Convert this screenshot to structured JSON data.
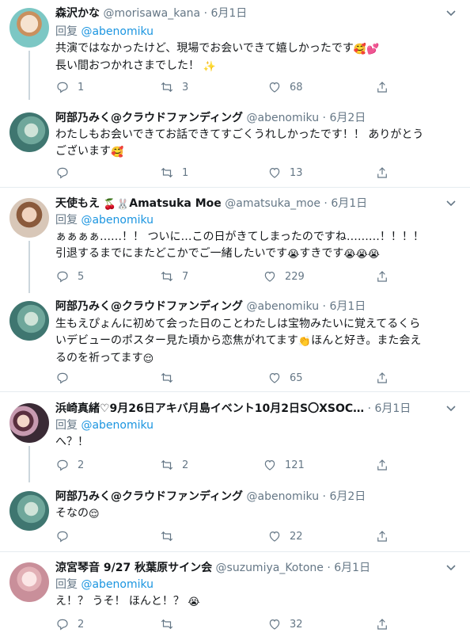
{
  "tweets": [
    {
      "name": "森沢かな",
      "handle": "@morisawa_kana",
      "time": "· 6月1日",
      "reply_prefix": "回复",
      "reply_to": "@abenomiku",
      "text1": "共演ではなかったけど、現場でお会いできて嬉しかったです",
      "emoji1": "🥰💕",
      "text2": "長い間おつかれさまでした！",
      "emoji2": "✨",
      "replies": "1",
      "retweets": "3",
      "likes": "68",
      "avatar_color": "#7cc7c4"
    },
    {
      "name": "阿部乃みく@クラウドファンディング",
      "handle": "@abenomiku",
      "time": "· 6月2日",
      "text1": "わたしもお会いできてお話できてすごくうれしかったです！！ ありがとう",
      "text2": "ございます",
      "emoji2": "🥰",
      "replies": "",
      "retweets": "1",
      "likes": "13",
      "avatar_color": "#4f8f88"
    },
    {
      "name": "天使もえ",
      "name_emoji": "🍒🐰",
      "name_tail": "Amatsuka Moe",
      "handle": "@amatsuka_moe",
      "time": "· 6月1日",
      "reply_prefix": "回复",
      "reply_to": "@abenomiku",
      "text1": "ぁぁぁぁ……！！ ついに…この日がきてしまったのですね………！！！！",
      "text2": "引退するまでにまたどこかでご一緒したいです",
      "emoji2a": "😭",
      "text2b": "すきです",
      "emoji2b": "😭😭😭",
      "replies": "5",
      "retweets": "7",
      "likes": "229",
      "avatar_color": "#b07a5a"
    },
    {
      "name": "阿部乃みく@クラウドファンディング",
      "handle": "@abenomiku",
      "time": "· 6月1日",
      "text1": "生もえぴょんに初めて会った日のことわたしは宝物みたいに覚えてるくら",
      "text2": "いデビューのポスター見た頃から恋焦がれてます",
      "emoji2a": "👏",
      "text2b": "ほんと好き。また会え",
      "text3": "るのを祈ってます",
      "emoji3": "😌",
      "replies": "",
      "retweets": "",
      "likes": "65",
      "avatar_color": "#4f8f88"
    },
    {
      "name": "浜崎真緒♡9月26日アキバ月島イベント10月2日S〇XSOC…",
      "handle": "",
      "time": "· 6月1日",
      "reply_prefix": "回复",
      "reply_to": "@abenomiku",
      "text1": "へ？！",
      "replies": "2",
      "retweets": "2",
      "likes": "121",
      "avatar_color": "#6b3f5a"
    },
    {
      "name": "阿部乃みく@クラウドファンディング",
      "handle": "@abenomiku",
      "time": "· 6月2日",
      "text1": "そなの",
      "emoji1": "😌",
      "replies": "",
      "retweets": "",
      "likes": "22",
      "avatar_color": "#4f8f88"
    },
    {
      "name": "涼宮琴音 9/27 秋葉原サイン会",
      "handle": "@suzumiya_Kotone",
      "time": "· 6月1日",
      "reply_prefix": "回复",
      "reply_to": "@abenomiku",
      "text1": "え！？ うそ！ ほんと！？",
      "emoji1": "😭",
      "replies": "2",
      "retweets": "",
      "likes": "32",
      "avatar_color": "#d9a8b0"
    }
  ]
}
